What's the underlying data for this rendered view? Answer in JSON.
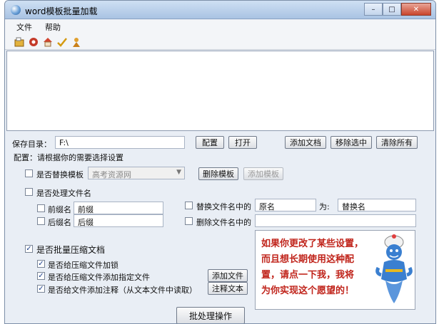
{
  "window": {
    "title": "word模板批量加载",
    "minimize_glyph": "–",
    "maximize_glyph": "□",
    "close_glyph": "✕"
  },
  "menu": [
    "文件",
    "帮助"
  ],
  "toolbar_icons": [
    "open-icon",
    "record-icon",
    "home-icon",
    "check-icon",
    "user-icon"
  ],
  "save": {
    "label": "保存目录：",
    "value": "F:\\",
    "config_button": "配置",
    "open_button": "打开",
    "add_doc_button": "添加文档",
    "remove_selected_button": "移除选中",
    "clear_all_button": "清除所有"
  },
  "config_hint": "配置：请根据你的需要选择设置",
  "replace_template": {
    "label": "是否替换模板",
    "checked": false,
    "combo_value": "高考资源网",
    "delete_button": "删除模板",
    "add_button": "添加模板"
  },
  "filename": {
    "label": "是否处理文件名",
    "checked": false,
    "prefix_label": "前缀名",
    "prefix_value": "前缀",
    "suffix_label": "后缀名",
    "suffix_value": "后缀",
    "replace_label": "替换文件名中的",
    "replace_from": "原名",
    "replace_to_label": "为:",
    "replace_to": "替换名",
    "delete_label": "删除文件名中的",
    "delete_value": ""
  },
  "compress": {
    "label": "是否批量压缩文档",
    "checked": true,
    "lock_label": "是否给压缩文件加锁",
    "lock_checked": true,
    "add_file_label": "是否给压缩文件添加指定文件",
    "add_file_checked": true,
    "comment_label": "是否给文件添加注释（从文本文件中读取）",
    "comment_checked": true,
    "add_file_button": "添加文件",
    "comment_button": "注释文本"
  },
  "tip": {
    "lines": [
      "如果你更改了某些设置，",
      "而且想长期使用这种配",
      "置，请点一下我，我将",
      "为你实现这个愿望的！"
    ]
  },
  "batch_button": "批处理操作",
  "colors": {
    "tip_text": "#c0241b",
    "genie_body": "#3a7fd0"
  }
}
